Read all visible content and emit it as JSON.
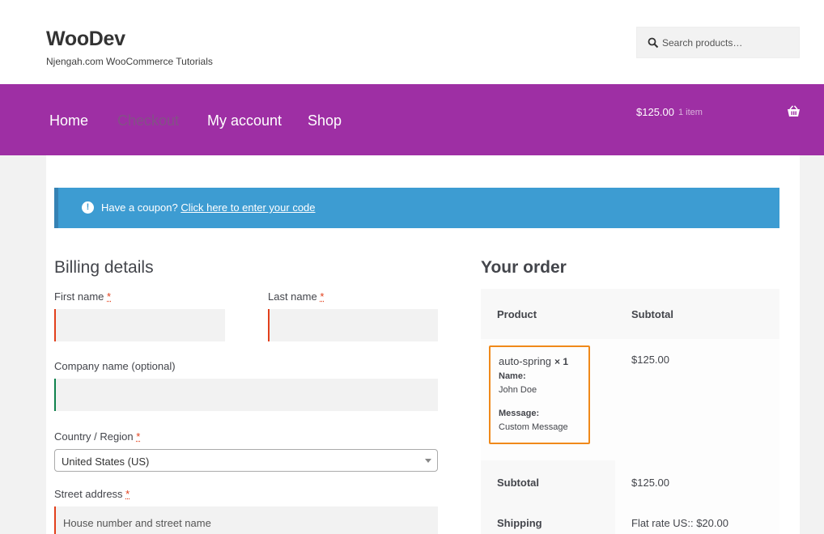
{
  "site": {
    "title": "WooDev",
    "description": "Njengah.com WooCommerce Tutorials"
  },
  "search": {
    "placeholder": "Search products…"
  },
  "nav": {
    "items": [
      {
        "label": "Home"
      },
      {
        "label": "Checkout"
      },
      {
        "label": "My account"
      },
      {
        "label": "Shop"
      }
    ],
    "active": "Checkout"
  },
  "cart": {
    "amount": "$125.00",
    "count": "1 item"
  },
  "coupon": {
    "text": "Have a coupon?",
    "link": "Click here to enter your code"
  },
  "billing": {
    "title": "Billing details",
    "first_name_label": "First name",
    "last_name_label": "Last name",
    "company_label": "Company name (optional)",
    "country_label": "Country / Region",
    "country_value": "United States (US)",
    "street_label": "Street address",
    "street_placeholder": "House number and street name",
    "required_mark": "*"
  },
  "order": {
    "title": "Your order",
    "col_product": "Product",
    "col_subtotal": "Subtotal",
    "item": {
      "name": "auto-spring",
      "qty": "× 1",
      "meta": [
        {
          "key": "Name:",
          "value": "John Doe"
        },
        {
          "key": "Message:",
          "value": "Custom Message"
        }
      ],
      "price": "$125.00"
    },
    "subtotal_label": "Subtotal",
    "subtotal_value": "$125.00",
    "shipping_label": "Shipping",
    "shipping_value": "Flat rate US:: $20.00"
  },
  "colors": {
    "nav_bg": "#9e2fa4",
    "coupon_bg": "#3d9cd2",
    "highlight": "#f0891a",
    "required": "#e2401c"
  }
}
